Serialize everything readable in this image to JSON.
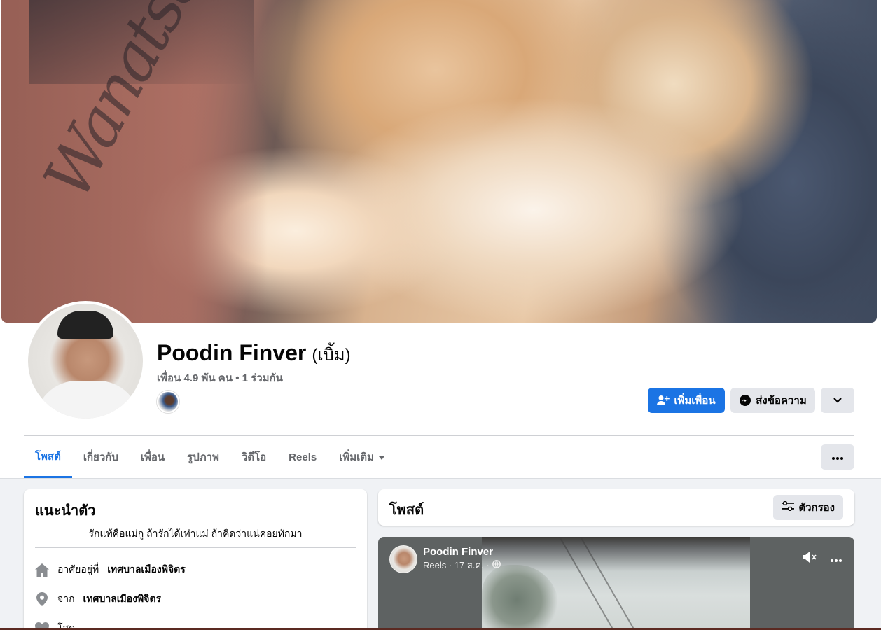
{
  "profile": {
    "name": "Poodin Finver",
    "nickname": "(เบิ้ม)",
    "friends_summary": "เพื่อน 4.9 พัน คน • 1 ร่วมกัน"
  },
  "cover": {
    "tattoo_text": "Wanatsara"
  },
  "actions": {
    "add_friend": "เพิ่มเพื่อน",
    "message": "ส่งข้อความ"
  },
  "tabs": [
    {
      "label": "โพสต์",
      "active": true
    },
    {
      "label": "เกี่ยวกับ"
    },
    {
      "label": "เพื่อน"
    },
    {
      "label": "รูปภาพ"
    },
    {
      "label": "วิดีโอ"
    },
    {
      "label": "Reels"
    },
    {
      "label": "เพิ่มเติม"
    }
  ],
  "intro": {
    "title": "แนะนำตัว",
    "bio": "รักแท้คือแม่กู ถ้ารักได้เท่าแม่ ถ้าคิดว่าแน่ค่อยทักมา",
    "lives_prefix": "อาศัยอยู่ที่",
    "lives_place": "เทศบาลเมืองพิจิตร",
    "from_prefix": "จาก",
    "from_place": "เทศบาลเมืองพิจิตร",
    "status_partial": "โสด"
  },
  "posts": {
    "title": "โพสต์",
    "filter_label": "ตัวกรอง"
  },
  "reel": {
    "author": "Poodin Finver",
    "meta": "Reels · 17 ส.ค. ·"
  },
  "colors": {
    "accent": "#1b74e4",
    "secondary_button": "#e4e6eb",
    "muted_text": "#65676b",
    "page_bg": "#f0f2f5"
  }
}
